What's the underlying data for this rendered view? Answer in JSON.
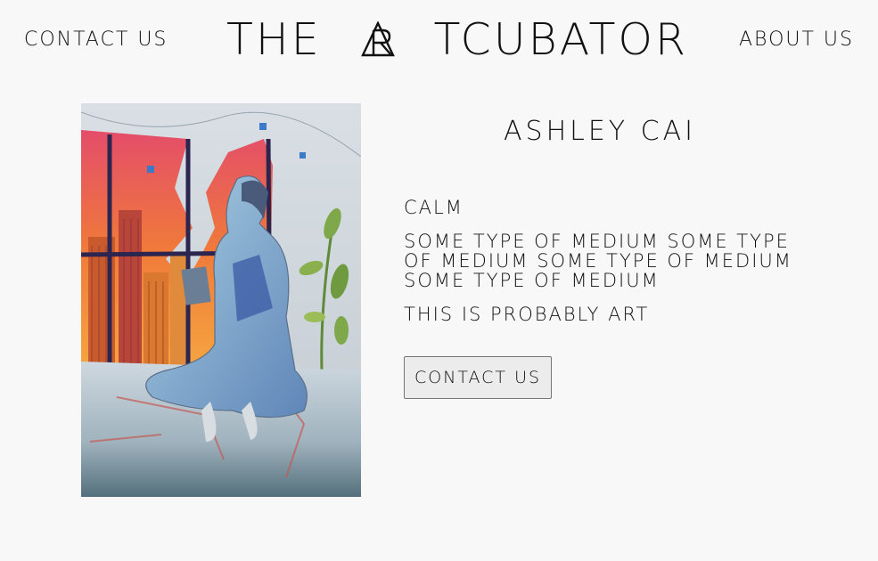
{
  "header": {
    "nav_left": "CONTACT US",
    "nav_right": "ABOUT US",
    "logo_text": "THE ARTCUBATOR"
  },
  "artwork": {
    "icon": "painting-image"
  },
  "details": {
    "artist_name": "ASHLEY CAI",
    "title": "CALM",
    "medium": "SOME TYPE OF MEDIUM SOME TYPE OF MEDIUM SOME TYPE OF MEDIUM SOME TYPE OF MEDIUM",
    "description": "THIS IS PROBABLY ART",
    "contact_button": "CONTACT US"
  },
  "colors": {
    "background": "#f8f8f8",
    "text": "#111111",
    "button_bg": "#ececec",
    "button_border": "#777777"
  }
}
